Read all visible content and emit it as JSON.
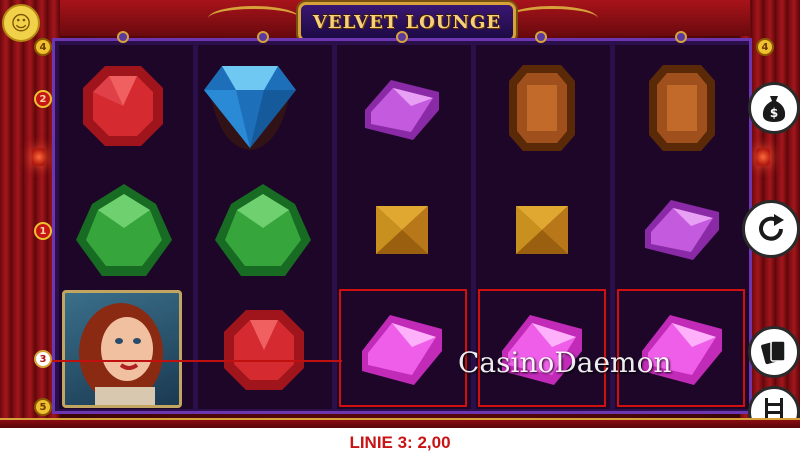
{
  "game": {
    "title": "VELVET LOUNGE",
    "logo_icon": "sun-smiley-icon"
  },
  "paylines": {
    "left": [
      "4",
      "2",
      "1",
      "3",
      "5"
    ],
    "right": [
      "4"
    ],
    "active_line": "3"
  },
  "reels": [
    {
      "symbols": [
        "red-gem",
        "green-gem",
        "woman-portrait"
      ]
    },
    {
      "symbols": [
        "blue-diamond",
        "green-gem",
        "red-gem"
      ]
    },
    {
      "symbols": [
        "purple-crystal",
        "gold-pyramid",
        "pink-crystal"
      ]
    },
    {
      "symbols": [
        "brown-gem",
        "gold-pyramid",
        "pink-crystal"
      ]
    },
    {
      "symbols": [
        "brown-gem",
        "purple-crystal",
        "pink-crystal"
      ]
    }
  ],
  "win_highlight": {
    "reels": [
      3,
      4,
      5
    ],
    "row": 3,
    "color": "#d01010"
  },
  "side_buttons": [
    {
      "name": "money-bag-icon",
      "symbol": "$"
    },
    {
      "name": "spin-icon"
    },
    {
      "name": "cards-icon"
    },
    {
      "name": "ladder-icon"
    }
  ],
  "status": {
    "text": "LINIE 3: 2,00"
  },
  "watermark": "CasinoDaemon",
  "colors": {
    "accent_gold": "#d7a23a",
    "reel_purple": "#6b36b0",
    "status_red": "#c81414"
  }
}
